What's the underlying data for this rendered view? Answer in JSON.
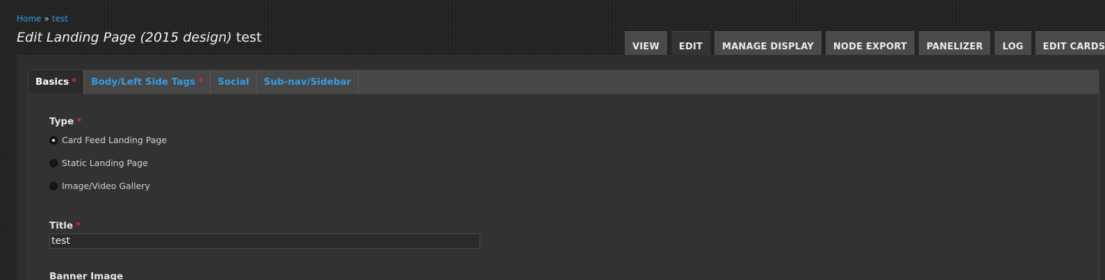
{
  "breadcrumb": {
    "home": "Home",
    "separator": "»",
    "current": "test"
  },
  "title": {
    "prefix": "Edit Landing Page (2015 design)",
    "node": "test"
  },
  "primary_tabs": [
    "VIEW",
    "EDIT",
    "MANAGE DISPLAY",
    "NODE EXPORT",
    "PANELIZER",
    "LOG",
    "EDIT CARDS"
  ],
  "primary_active": "EDIT",
  "vertical_tabs": [
    {
      "label": "Basics",
      "required": true
    },
    {
      "label": "Body/Left Side Tags",
      "required": true
    },
    {
      "label": "Social",
      "required": false
    },
    {
      "label": "Sub-nav/Sidebar",
      "required": false
    }
  ],
  "required_marker": "*",
  "type_field": {
    "label": "Type",
    "options": [
      "Card Feed Landing Page",
      "Static Landing Page",
      "Image/Video Gallery"
    ],
    "selected": "Card Feed Landing Page"
  },
  "title_field": {
    "label": "Title",
    "value": "test"
  },
  "banner_field": {
    "label": "Banner Image"
  },
  "colors": {
    "link": "#3a9be0",
    "required": "#e0262b",
    "tab_bg": "#4a4a4a",
    "active_tab_bg": "#343434"
  }
}
